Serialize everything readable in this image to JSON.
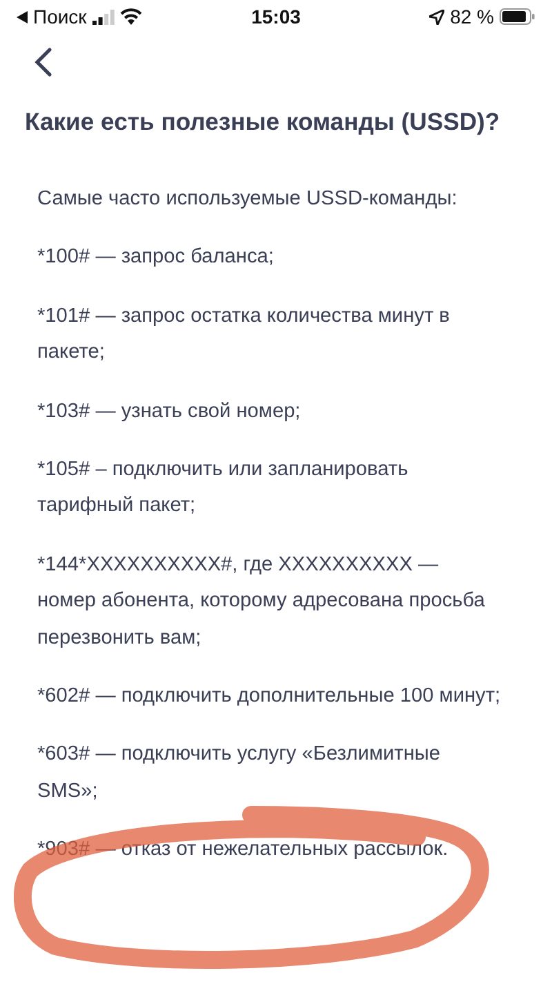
{
  "status_bar": {
    "back_label": "Поиск",
    "time": "15:03",
    "battery": "82 %"
  },
  "title": "Какие есть полезные команды (USSD)?",
  "paragraphs": [
    "Самые часто используемые USSD-команды:",
    "*100# — запрос баланса;",
    "*101# — запрос остатка количества минут в пакете;",
    "*103# — узнать свой номер;",
    "*105# – подключить или запланировать тарифный пакет;",
    "*144*ХХХХХХХХХХ#, где ХХХХХХХХХХ — номер абонента, которому адресована просьба перезвонить вам;",
    "*602# — подключить дополнительные 100 минут;",
    "*603# — подключить услугу «Безлимитные SMS»;",
    "*903# — отказ от нежелательных рассылок."
  ]
}
